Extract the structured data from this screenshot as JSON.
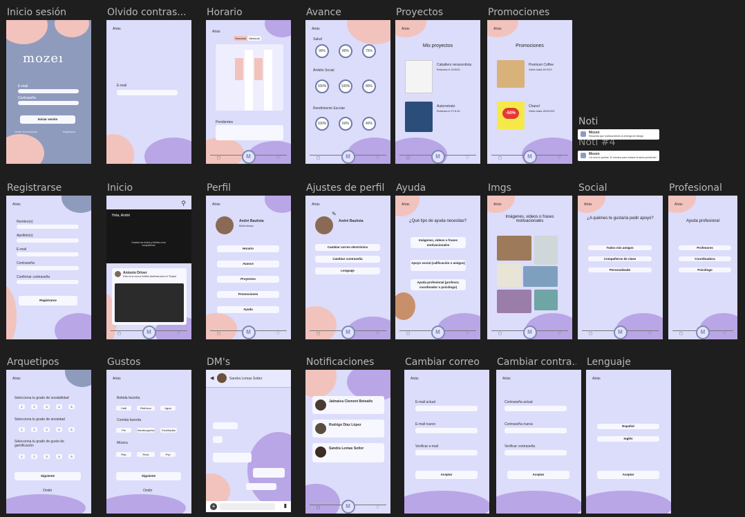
{
  "frames": {
    "inicio_sesion": {
      "label": "Inicio sesión",
      "logo": "mozeı",
      "email": "E-mail",
      "password": "Contraseña",
      "login": "Iniciar sesión",
      "forgot": "Olvidé mi contraseña",
      "register": "Registrarse"
    },
    "olvido": {
      "label": "Olvido contras...",
      "back": "Atrás",
      "email": "E-mail"
    },
    "horario": {
      "label": "Horario",
      "back": "Atrás",
      "tab1": "Semanal",
      "tab2": "Mensual",
      "pending": "Pendientes",
      "days": [
        "Hora",
        "Lunes",
        "Martes",
        "Miércoles",
        "Jueves",
        "Viernes"
      ]
    },
    "avance": {
      "label": "Avance",
      "back": "Atrás",
      "sec1": "Salud",
      "sec2": "Ámbito Social",
      "sec3": "Rendimiento Escolar",
      "pcts1": [
        "90%",
        "80%",
        "75%"
      ],
      "pcts2": [
        "100%",
        "100%",
        "80%"
      ],
      "pcts3": [
        "100%",
        "60%",
        "40%"
      ]
    },
    "proyectos": {
      "label": "Proyectos",
      "back": "Atrás",
      "title": "Mis proyectos",
      "p1": "Caballero renacentista",
      "p2": "Autorretrato",
      "p1_date": "Realizado el 12/05/21",
      "p2_date": "Realizado el 27/11/20"
    },
    "promociones": {
      "label": "Promociones",
      "back": "Atrás",
      "title": "Promociones",
      "p1": "Premium Coffee",
      "p2": "Chanel",
      "p1_date": "Válido hasta 20/10/21",
      "p2_date": "Válido hasta 15/09/2021",
      "badge": "-50%"
    },
    "noti": {
      "label": "Noti",
      "label2": "Noti #4",
      "n1_title": "Mozen",
      "n1_text": "Recuerda que mañana tienes la entrega de trabajo",
      "n2_title": "Mozen",
      "n2_text": "¡Ya solo te quedan 10 minutos para realizar la tarea pendiente!"
    },
    "registrarse": {
      "label": "Registrarse",
      "back": "Atrás",
      "fields": [
        "Nombre(s)",
        "Apellido(s)",
        "E-mail",
        "Contraseña",
        "Confirmar contraseña"
      ],
      "submit": "Registrarse"
    },
    "inicio": {
      "label": "Inicio",
      "greeting": "Hola, André",
      "banner": "Gradúa tus éxitos y felicita a tus compañeros",
      "post_name": "Antonio Driver",
      "post_text": "Esta es la nueva botella diseñada para mi Tequila"
    },
    "perfil": {
      "label": "Perfil",
      "back": "Atrás",
      "name": "André Bautista",
      "sub": "Medio tiempo",
      "buttons": [
        "Horario",
        "Avance",
        "Proyectos",
        "Promociones",
        "Ayuda"
      ]
    },
    "ajustes": {
      "label": "Ajustes de perfil",
      "back": "Atrás",
      "name": "André Bautista",
      "buttons": [
        "Cambiar correo electrónico",
        "Cambiar contraseña",
        "Lenguaje"
      ]
    },
    "ayuda": {
      "label": "Ayuda",
      "back": "Atrás",
      "title": "¿Qué tipo de ayuda necesitas?",
      "buttons": [
        "Imágenes, videos o frases motivacionales",
        "Apoyo social (calificación o amigos)",
        "Ayuda profesional (profesor, coordinador o psicólogo)"
      ]
    },
    "imgs": {
      "label": "Imgs",
      "back": "Atrás",
      "title": "Imágenes, videos o frases motivacionales"
    },
    "social": {
      "label": "Social",
      "back": "Atrás",
      "title": "¿A quiénes te gustaría pedir apoyo?",
      "buttons": [
        "Todos mis amigos",
        "Compañeros de clase",
        "Personalizado"
      ]
    },
    "profesional": {
      "label": "Profesional",
      "back": "Atrás",
      "title": "Ayuda profesional",
      "buttons": [
        "Profesores",
        "Coordinadora",
        "Psicólogo"
      ]
    },
    "arquetipos": {
      "label": "Arquetipos",
      "back": "Atrás",
      "q1": "Selecciona tu grado de sociabilidad",
      "q2": "Selecciona tu grado de ansiedad",
      "q3": "Selecciona tu grado de gusto de gamificación",
      "nums": [
        "1",
        "2",
        "3",
        "4",
        "5"
      ],
      "next": "Siguiente",
      "skip": "Omitir"
    },
    "gustos": {
      "label": "Gustos",
      "back": "Atrás",
      "g1": "Bebida favorita",
      "g1_items": [
        "Café",
        "Refresco",
        "Agua"
      ],
      "g2": "Comida favorita",
      "g2_items": [
        "Pie",
        "Hamburguesa",
        "Enchiladas"
      ],
      "g3": "Música",
      "g3_items": [
        "Rap",
        "Rock",
        "Pop"
      ],
      "next": "Siguiente",
      "skip": "Omitir"
    },
    "dms": {
      "label": "DM's",
      "contact": "Sandra Lomas Sotter"
    },
    "notificaciones": {
      "label": "Notificaciones",
      "n1": "Jalmaica Clement Beteaño",
      "n2": "Rodrigo Díaz López",
      "n3": "Sandra Lomas Sotter"
    },
    "cambiar_correo": {
      "label": "Cambiar correo",
      "back": "Atrás",
      "f1": "E-mail actual",
      "f2": "E-mail nuevo",
      "f3": "Verificar e-mail",
      "accept": "Aceptar"
    },
    "cambiar_contra": {
      "label": "Cambiar contra...",
      "back": "Atrás",
      "f1": "Contraseña actual",
      "f2": "Contraseña nueva",
      "f3": "Verificar contraseña",
      "accept": "Aceptar"
    },
    "lenguaje": {
      "label": "Lenguaje",
      "back": "Atrás",
      "opt1": "Español",
      "opt2": "Inglés",
      "accept": "Aceptar"
    }
  }
}
